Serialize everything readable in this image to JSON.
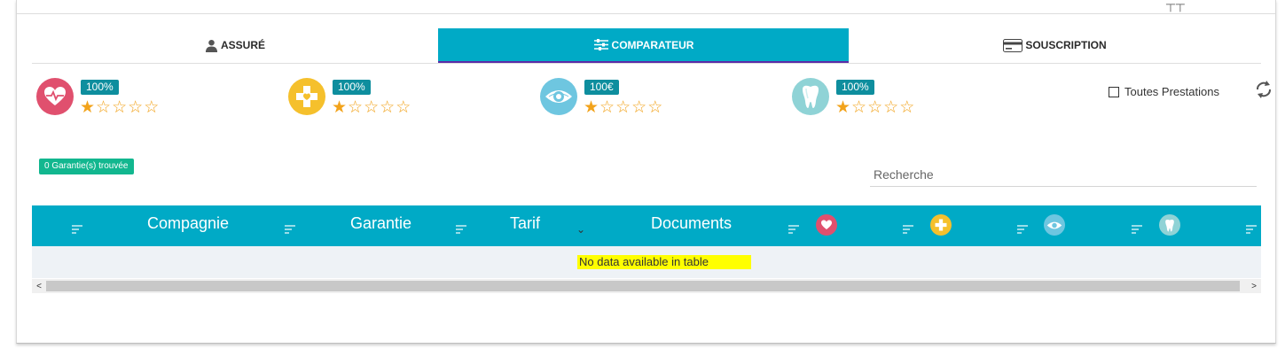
{
  "top": {
    "glyph": "┬┬"
  },
  "tabs": [
    {
      "label": "ASSURÉ",
      "icon": "user-icon",
      "active": false
    },
    {
      "label": "COMPARATEUR",
      "icon": "sliders-icon",
      "active": true
    },
    {
      "label": "SOUSCRIPTION",
      "icon": "credit-card-icon",
      "active": false
    }
  ],
  "stats": [
    {
      "icon": "heart-monitor-icon",
      "color": "#e0506e",
      "value": "100%",
      "rating": 1,
      "max": 5
    },
    {
      "icon": "medical-cross-icon",
      "color": "#f5c02c",
      "value": "100%",
      "rating": 1,
      "max": 5
    },
    {
      "icon": "eye-icon",
      "color": "#6ec6e0",
      "value": "100€",
      "rating": 1,
      "max": 5
    },
    {
      "icon": "tooth-icon",
      "color": "#8fd3d6",
      "value": "100%",
      "rating": 1,
      "max": 5
    }
  ],
  "all_services": {
    "label": "Toutes Prestations",
    "checked": false
  },
  "found_badge": "0 Garantie(s) trouvée",
  "search": {
    "placeholder": "Recherche",
    "value": ""
  },
  "table": {
    "columns": [
      "Compagnie",
      "Garantie",
      "Tarif",
      "Documents"
    ],
    "icon_columns": [
      "heart-monitor-icon",
      "medical-cross-icon",
      "eye-icon",
      "tooth-icon"
    ],
    "empty_message": "No data available in table"
  },
  "colors": {
    "accent": "#00aac6",
    "tab_underline": "#5b2ba8",
    "badge": "#0e8e9e",
    "success": "#12b78f",
    "star": "#f2a31b"
  }
}
